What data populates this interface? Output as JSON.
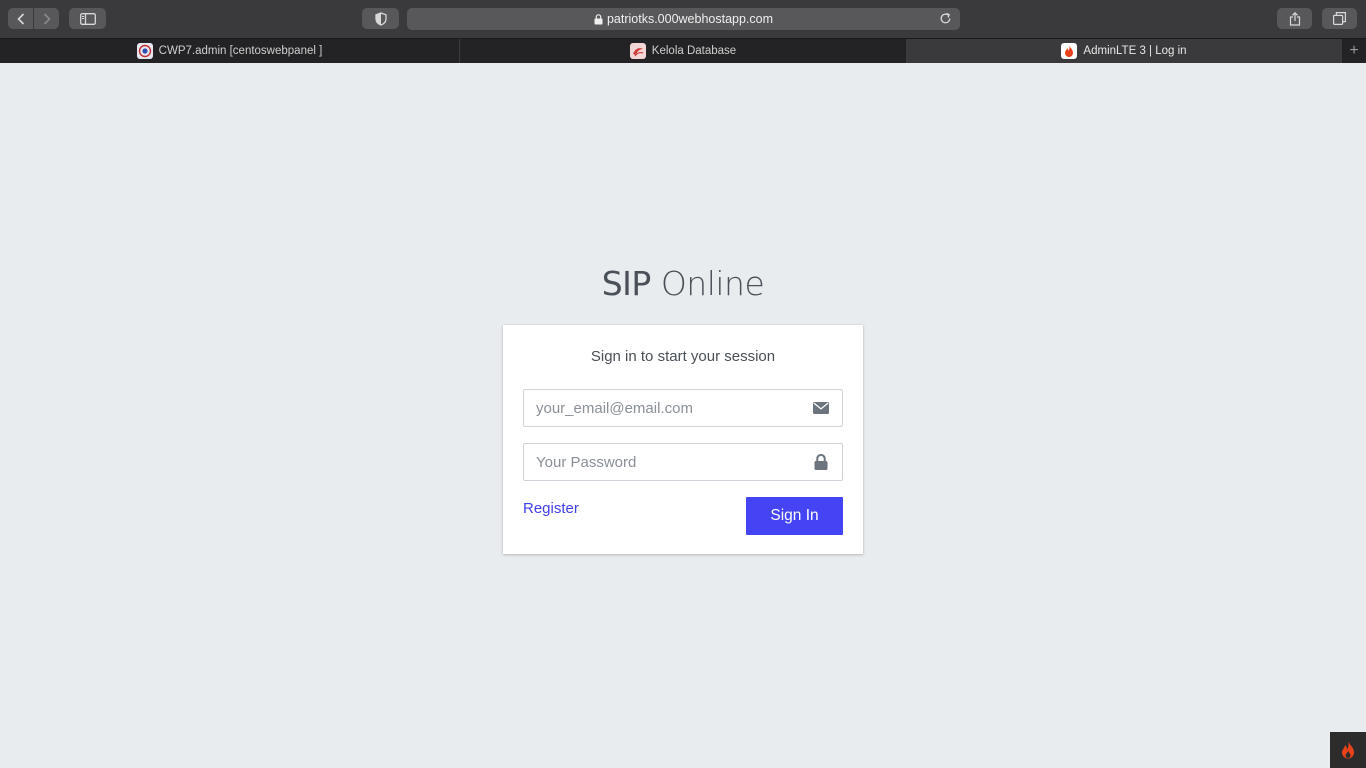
{
  "browser": {
    "url": "patriotks.000webhostapp.com",
    "tabs": [
      {
        "title": "CWP7.admin [centoswebpanel ]",
        "active": false,
        "icon": "cwp-favicon"
      },
      {
        "title": "Kelola Database",
        "active": false,
        "icon": "phpmyadmin-favicon"
      },
      {
        "title": "AdminLTE 3 | Log in",
        "active": true,
        "icon": "flame-favicon"
      }
    ]
  },
  "login": {
    "brand_bold": "SIP",
    "brand_light": "Online",
    "message": "Sign in to start your session",
    "email_placeholder": "your_email@email.com",
    "password_placeholder": "Your Password",
    "register_label": "Register",
    "signin_label": "Sign In"
  },
  "colors": {
    "background": "#e9ecef",
    "primary_button": "#4444f5",
    "link": "#4040e8"
  }
}
